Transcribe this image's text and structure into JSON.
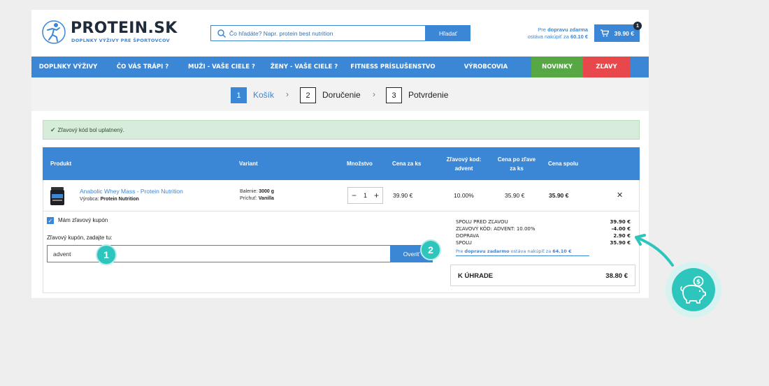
{
  "header": {
    "logo_text": "PROTEIN.SK",
    "logo_tagline": "DOPLNKY VÝŽIVY PRE ŠPORTOVCOV",
    "search_placeholder": "Čo hľadáte? Napr. protein best nutrition",
    "search_button": "Hľadať",
    "shipping_prefix": "Pre",
    "shipping_bold": "dopravu zdarma",
    "shipping_mid": "ostáva nakúpiť za",
    "shipping_amount": "60.10 €",
    "cart_total": "39.90 €",
    "cart_count": "1"
  },
  "nav": {
    "items": [
      {
        "label": "DOPLNKY VÝŽIVY",
        "color": "#3b87d6"
      },
      {
        "label": "ČO VÁS TRÁPI ?",
        "color": "#3b87d6"
      },
      {
        "label": "MUŽI - VAŠE CIELE ?",
        "color": "#3b87d6"
      },
      {
        "label": "ŽENY - VAŠE CIELE ?",
        "color": "#3b87d6"
      },
      {
        "label": "FITNESS PRÍSLUŠENSTVO",
        "color": "#3b87d6"
      },
      {
        "label": "VÝROBCOVIA",
        "color": "#3b87d6"
      },
      {
        "label": "NOVINKY",
        "color": "#57a845"
      },
      {
        "label": "ZĽAVY",
        "color": "#e8474c"
      }
    ]
  },
  "steps": [
    {
      "num": "1",
      "label": "Košík",
      "active": true
    },
    {
      "num": "2",
      "label": "Doručenie",
      "active": false
    },
    {
      "num": "3",
      "label": "Potvrdenie",
      "active": false
    }
  ],
  "alert": {
    "message": "Zľavový kód bol uplatnený."
  },
  "table": {
    "headers": [
      "Produkt",
      "Variant",
      "Množstvo",
      "Cena za ks",
      "Zľavový kod: advent",
      "Cena po zľave za ks",
      "Cena spolu"
    ],
    "row": {
      "name": "Anabolic Whey Mass - Protein Nutrition",
      "maker_label": "Výrobca:",
      "maker": "Protein Nutrition",
      "pack_label": "Balenie:",
      "pack": "3000 g",
      "flavor_label": "Príchuť:",
      "flavor": "Vanilla",
      "quantity": "1",
      "price": "39.90 €",
      "discount": "10.00%",
      "discounted_price": "35.90 €",
      "total": "35.90 €"
    }
  },
  "coupon": {
    "checkbox_label": "Mám zľavový kupón",
    "field_label": "Zľavový kupón, zadajte tu:",
    "value": "advent",
    "verify_button": "Overiť"
  },
  "summary": {
    "rows": [
      {
        "k": "SPOLU PRED ZĽAVOU",
        "v": "39.90 €"
      },
      {
        "k": "ZĽAVOVÝ KÓD: ADVENT: 10.00%",
        "v": "-4.00 €"
      },
      {
        "k": "DOPRAVA",
        "v": "2.90 €"
      },
      {
        "k": "SPOLU",
        "v": "35.90 €"
      }
    ],
    "note_prefix": "Pre",
    "note_bold": "dopravu zadarmo",
    "note_mid": "ostáva nakúpiť za",
    "note_amount": "64.10 €",
    "total_label": "K ÚHRADE",
    "total_value": "38.80 €"
  },
  "annotations": {
    "badge1": "1",
    "badge2": "2"
  },
  "colors": {
    "accent": "#3b87d6",
    "teal": "#2ec5bd",
    "green": "#57a845",
    "red": "#e8474c"
  }
}
